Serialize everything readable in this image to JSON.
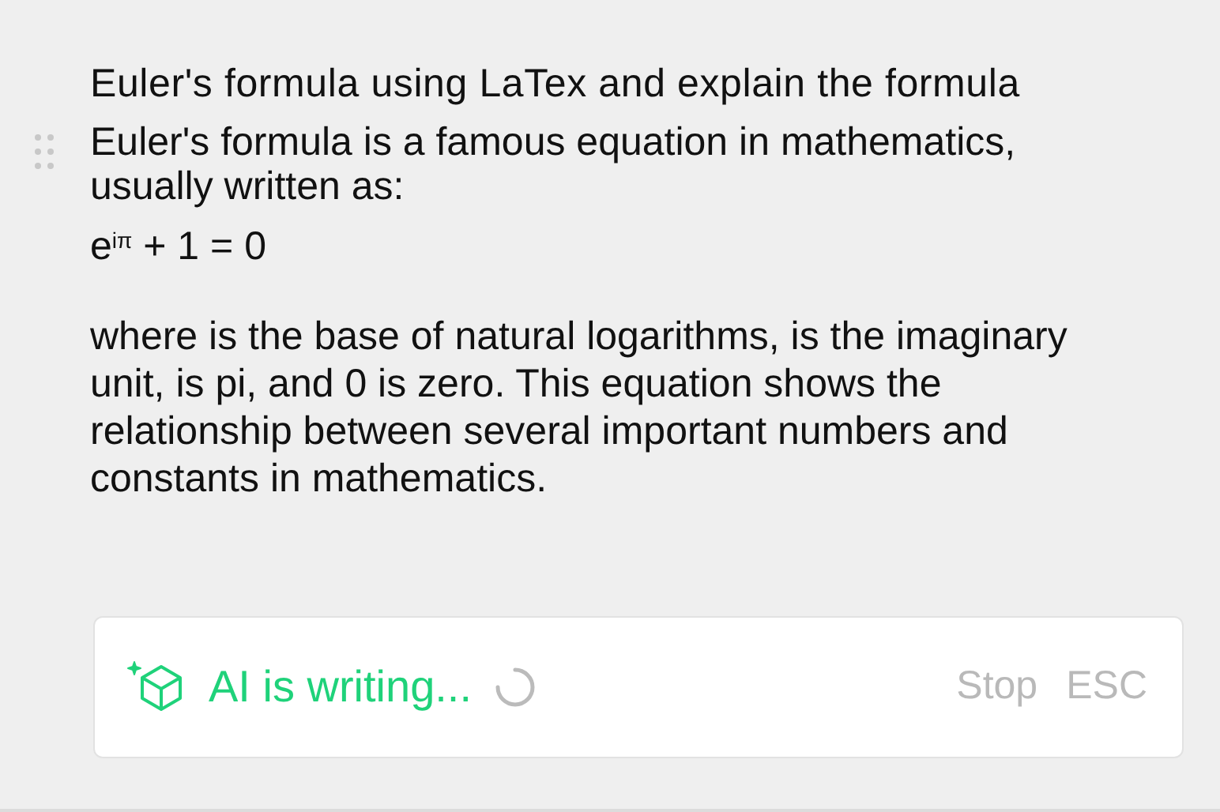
{
  "prompt": "Euler's formula using LaTex and explain the formula",
  "answer": {
    "intro": "Euler's formula is a famous equation in mathematics, usually written as:",
    "formula": "e$^{iπ}$ + 1 = 0",
    "explanation": "where is the base of natural logarithms, is the imaginary unit, is pi, and 0 is zero. This equation shows the relationship between several important numbers and constants in mathematics."
  },
  "status": {
    "label": "AI is writing...",
    "loading": true,
    "stop": "Stop",
    "shortcut": "ESC"
  }
}
